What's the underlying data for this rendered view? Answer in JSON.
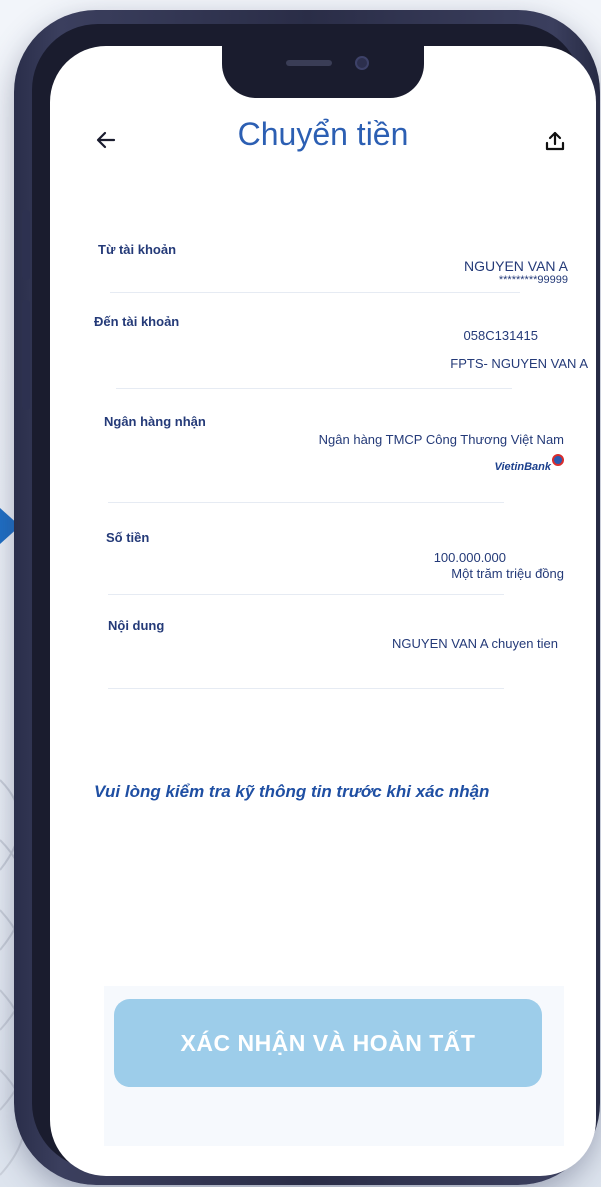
{
  "header": {
    "title": "Chuyển tiền",
    "back_icon": "arrow-left-icon",
    "share_icon": "share-upload-icon"
  },
  "form": {
    "from_account": {
      "label": "Từ tài khoản",
      "name": "NGUYEN VAN A",
      "number": "*********99999"
    },
    "to_account": {
      "label": "Đến tài khoản",
      "number": "058C131415",
      "name": "FPTS- NGUYEN VAN A"
    },
    "bank": {
      "label": "Ngân hàng nhận",
      "name": "Ngân hàng TMCP Công Thương Việt Nam",
      "logo_text": "VietinBank"
    },
    "amount": {
      "label": "Số tiền",
      "value": "100.000.000",
      "in_words": "Một trăm triệu đồng"
    },
    "content": {
      "label": "Nội dung",
      "value": "NGUYEN VAN A chuyen tien"
    }
  },
  "notice": "Vui lòng kiểm tra kỹ thông tin trước khi xác nhận",
  "confirm_button": "XÁC NHẬN VÀ HOÀN TẤT",
  "colors": {
    "title": "#2c5fb3",
    "text": "#243a78",
    "button": "#9dcdea",
    "frame": "#2a2e4a"
  }
}
